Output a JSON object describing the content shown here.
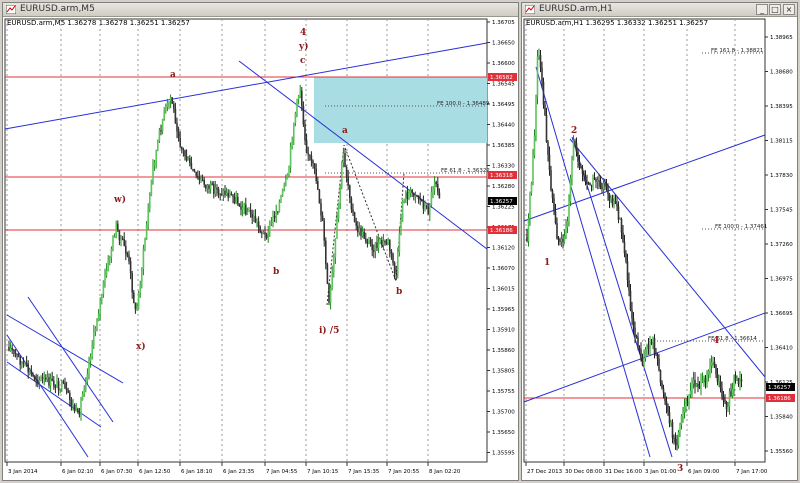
{
  "windows": {
    "m5": {
      "title": "EURUSD.arm,M5",
      "info": "EURUSD.arm,M5  1.36278 1.36278 1.36251 1.36257",
      "price_ticks": [
        "1.36705",
        "1.36650",
        "1.36600",
        "1.36545",
        "1.36495",
        "1.36440",
        "1.36385",
        "1.36330",
        "1.36280",
        "1.36225",
        "1.36175",
        "1.36120",
        "1.36070",
        "1.36015",
        "1.35965",
        "1.35910",
        "1.35860",
        "1.35805",
        "1.35755",
        "1.35700",
        "1.35650",
        "1.35595"
      ],
      "time_ticks": [
        "3 Jan 2014",
        "6 Jan 02:10",
        "6 Jan 07:30",
        "6 Jan 12:50",
        "6 Jan 18:10",
        "6 Jan 23:35",
        "7 Jan 04:55",
        "7 Jan 10:15",
        "7 Jan 15:35",
        "7 Jan 20:55",
        "8 Jan 02:20"
      ],
      "badges": [
        {
          "text": "1.36582",
          "color": "#e0303a"
        },
        {
          "text": "1.36318",
          "color": "#e0303a"
        },
        {
          "text": "1.36257",
          "color": "#000000"
        },
        {
          "text": "1.36186",
          "color": "#e0303a"
        }
      ],
      "fibo": [
        "FE 100.0 - 1.36489",
        "FE 61.8 - 1.36322"
      ],
      "wave_labels": [
        "4",
        "y)",
        "c",
        "a",
        "a",
        "w)",
        "b",
        "b",
        "x)",
        "i) /5"
      ]
    },
    "h1": {
      "title": "EURUSD.arm,H1",
      "info": "EURUSD.arm,H1  1.36295 1.36332 1.36251 1.36257",
      "price_ticks": [
        "1.38965",
        "1.38680",
        "1.38395",
        "1.38115",
        "1.37830",
        "1.37545",
        "1.37260",
        "1.36975",
        "1.36695",
        "1.36410",
        "1.36125",
        "1.35840",
        "1.35560"
      ],
      "time_ticks": [
        "27 Dec 2013",
        "30 Dec 08:00",
        "31 Dec 16:00",
        "3 Jan 01:00",
        "6 Jan 09:00",
        "7 Jan 17:00"
      ],
      "badges": [
        {
          "text": "1.36257",
          "color": "#000000"
        },
        {
          "text": "1.36186",
          "color": "#e0303a"
        }
      ],
      "fibo": [
        "FE 161.8 - 1.38821",
        "FE 100.0 - 1.37461",
        "FE 61.8 - 1.36614"
      ],
      "wave_labels": [
        "2",
        "1",
        "4",
        "3"
      ]
    }
  }
}
